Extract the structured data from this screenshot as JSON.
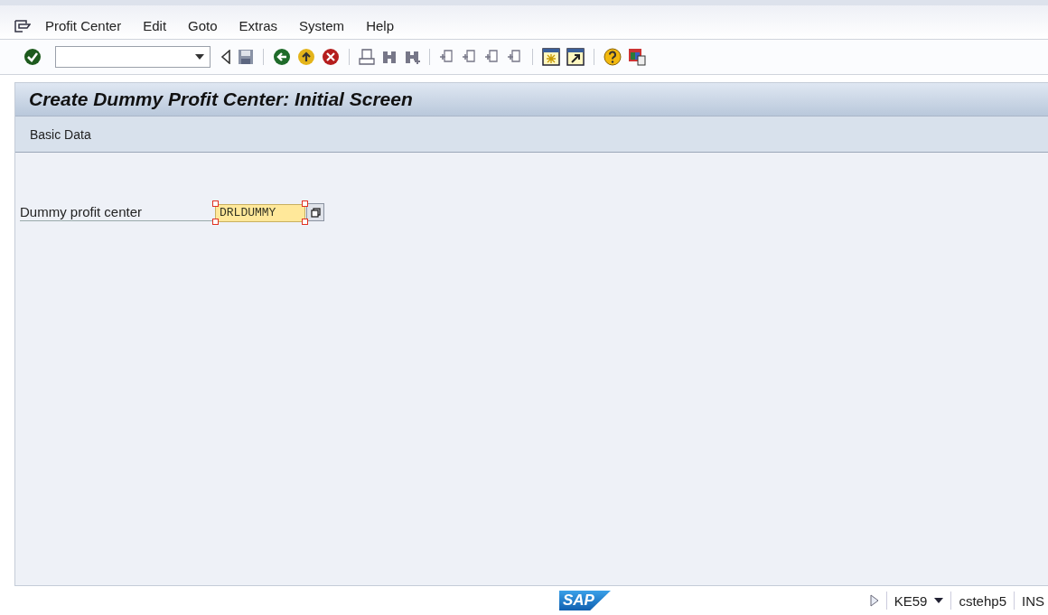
{
  "menu": [
    {
      "label": "Profit Center"
    },
    {
      "label": "Edit"
    },
    {
      "label": "Goto"
    },
    {
      "label": "Extras"
    },
    {
      "label": "System"
    },
    {
      "label": "Help"
    }
  ],
  "screen": {
    "title": "Create Dummy Profit Center: Initial Screen",
    "application_toolbar": [
      {
        "label": "Basic Data"
      }
    ],
    "fields": [
      {
        "label": "Dummy profit center",
        "value": "DRLDUMMY",
        "selected": true
      }
    ]
  },
  "status_bar": {
    "logo": "SAP",
    "transaction": "KE59",
    "server": "cstehp5",
    "mode": "INS"
  }
}
